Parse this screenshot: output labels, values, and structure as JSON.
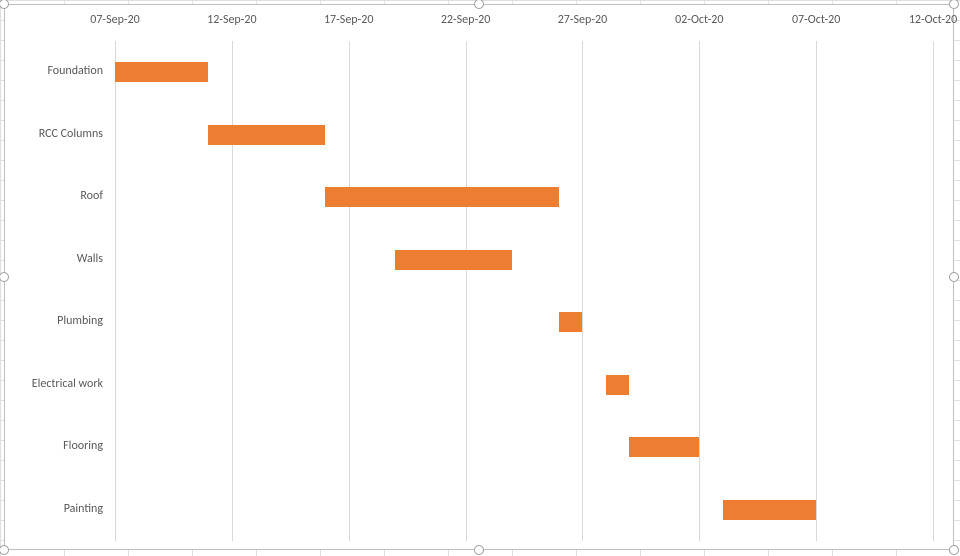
{
  "chart_data": {
    "type": "bar",
    "orientation": "horizontal",
    "style": "gantt",
    "x_axis": {
      "type": "date",
      "min": "2020-09-07",
      "max": "2020-10-12",
      "major_unit_days": 5,
      "ticks": [
        "07-Sep-20",
        "12-Sep-20",
        "17-Sep-20",
        "22-Sep-20",
        "27-Sep-20",
        "02-Oct-20",
        "07-Oct-20",
        "12-Oct-20"
      ]
    },
    "categories": [
      "Foundation",
      "RCC Columns",
      "Roof",
      "Walls",
      "Plumbing",
      "Electrical work",
      "Flooring",
      "Painting"
    ],
    "tasks": [
      {
        "name": "Foundation",
        "start": "2020-09-07",
        "duration_days": 4
      },
      {
        "name": "RCC Columns",
        "start": "2020-09-11",
        "duration_days": 5
      },
      {
        "name": "Roof",
        "start": "2020-09-16",
        "duration_days": 10
      },
      {
        "name": "Walls",
        "start": "2020-09-19",
        "duration_days": 5
      },
      {
        "name": "Plumbing",
        "start": "2020-09-26",
        "duration_days": 1
      },
      {
        "name": "Electrical work",
        "start": "2020-09-28",
        "duration_days": 1
      },
      {
        "name": "Flooring",
        "start": "2020-09-29",
        "duration_days": 3
      },
      {
        "name": "Painting",
        "start": "2020-10-03",
        "duration_days": 4
      }
    ],
    "bar_color": "#ed7d31",
    "gridline_color": "#d9d9d9",
    "title": "",
    "xlabel": "",
    "ylabel": ""
  },
  "ui": {
    "selection_handles": true
  }
}
